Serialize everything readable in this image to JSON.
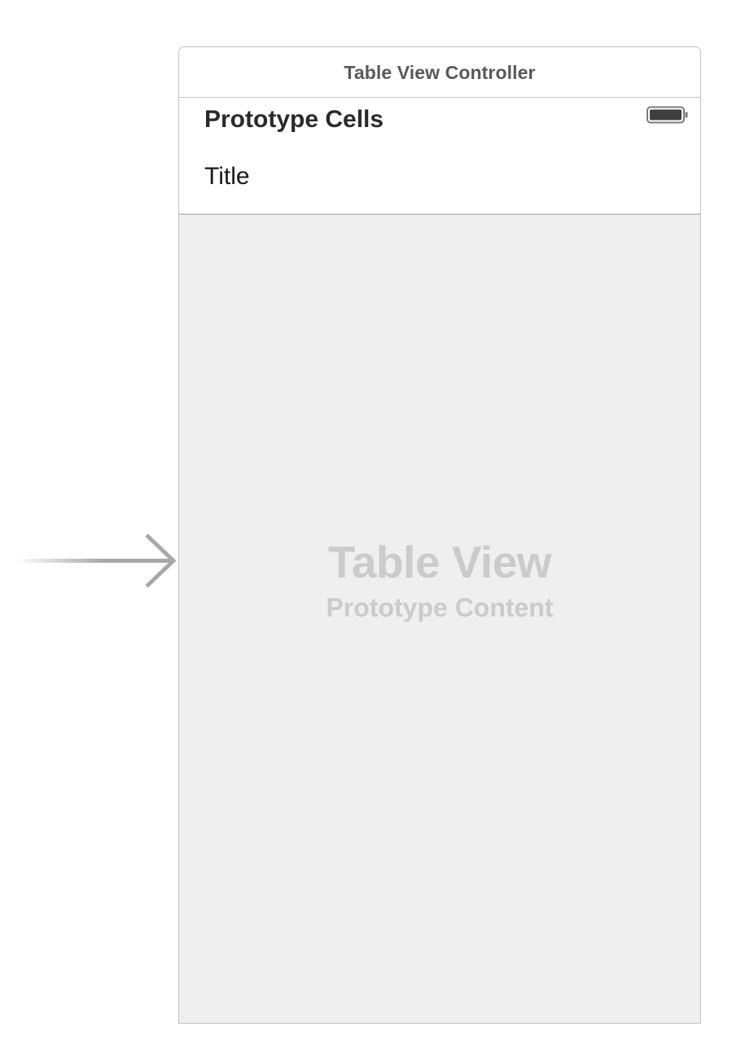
{
  "scene": {
    "title": "Table View Controller"
  },
  "table": {
    "section_title": "Prototype Cells",
    "cell_title": "Title",
    "placeholder_title": "Table View",
    "placeholder_subtitle": "Prototype Content"
  },
  "icons": {
    "entry_point": "entry-point-arrow-icon",
    "status": "battery-icon"
  },
  "colors": {
    "canvas": "#ffffff",
    "table_background": "#efefef",
    "border": "#c2c2c2",
    "placeholder_text": "#cbcbcb",
    "arrow": "#a8a8a8"
  }
}
